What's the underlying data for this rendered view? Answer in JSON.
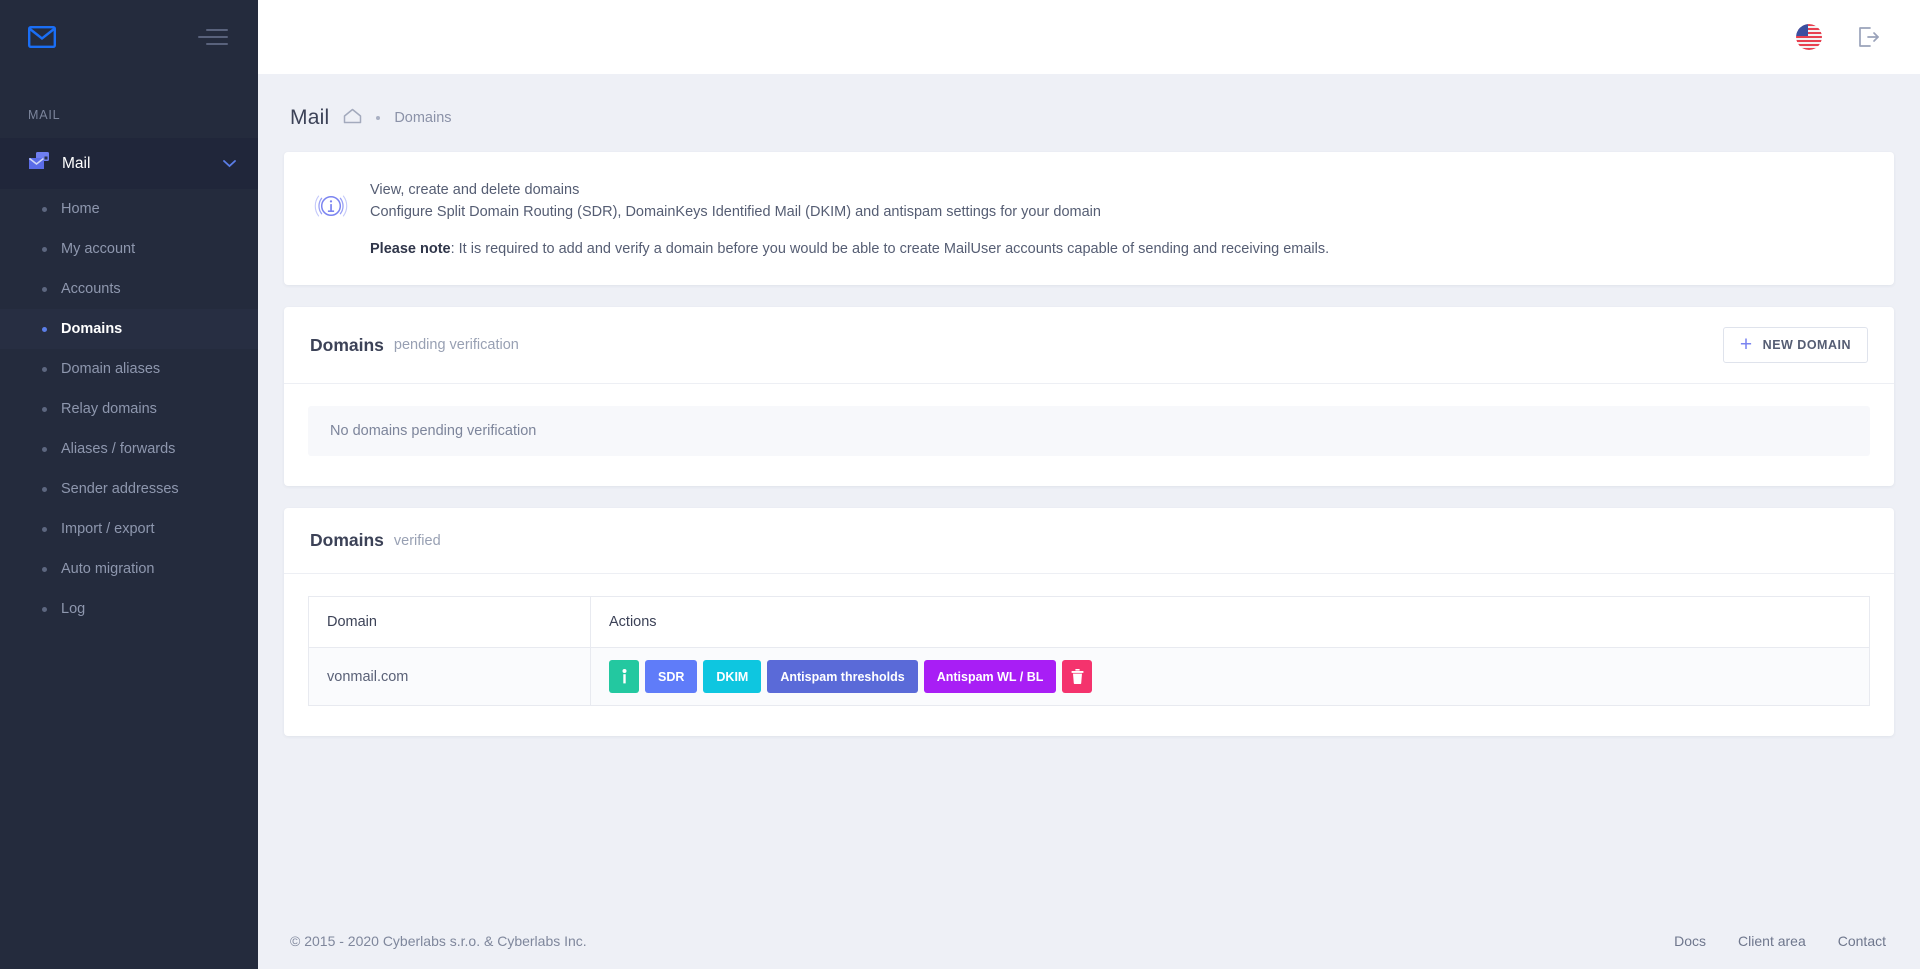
{
  "sidebar": {
    "logo_icon": "envelope-icon",
    "menu_icon": "hamburger-icon",
    "section_label": "MAIL",
    "group": {
      "label": "Mail",
      "icon": "mail-stack-icon",
      "chevron": "chevron-down-icon"
    },
    "items": [
      {
        "label": "Home",
        "active": false
      },
      {
        "label": "My account",
        "active": false
      },
      {
        "label": "Accounts",
        "active": false
      },
      {
        "label": "Domains",
        "active": true
      },
      {
        "label": "Domain aliases",
        "active": false
      },
      {
        "label": "Relay domains",
        "active": false
      },
      {
        "label": "Aliases / forwards",
        "active": false
      },
      {
        "label": "Sender addresses",
        "active": false
      },
      {
        "label": "Import / export",
        "active": false
      },
      {
        "label": "Auto migration",
        "active": false
      },
      {
        "label": "Log",
        "active": false
      }
    ]
  },
  "topbar": {
    "language_icon": "us-flag-icon",
    "logout_icon": "logout-icon"
  },
  "page": {
    "title": "Mail",
    "home_icon": "home-icon",
    "breadcrumb": "Domains"
  },
  "notice": {
    "icon": "info-circle-icon",
    "line1": "View, create and delete domains",
    "line2": "Configure Split Domain Routing (SDR), DomainKeys Identified Mail (DKIM) and antispam settings for your domain",
    "note_label": "Please note",
    "note_text": ": It is required to add and verify a domain before you would be able to create MailUser accounts capable of sending and receiving emails."
  },
  "pending_section": {
    "title": "Domains",
    "subtitle": "pending verification",
    "new_button": {
      "label": "NEW DOMAIN",
      "icon": "plus-icon"
    },
    "empty_text": "No domains pending verification"
  },
  "verified_section": {
    "title": "Domains",
    "subtitle": "verified",
    "columns": [
      "Domain",
      "Actions"
    ],
    "rows": [
      {
        "domain": "vonmail.com",
        "actions": [
          {
            "name": "info-button",
            "label": "",
            "icon": "info-icon",
            "color": "#23c8a0"
          },
          {
            "name": "sdr-button",
            "label": "SDR",
            "icon": "",
            "color": "#5f7cf9"
          },
          {
            "name": "dkim-button",
            "label": "DKIM",
            "icon": "",
            "color": "#0ec6e0"
          },
          {
            "name": "antispam-thresholds-button",
            "label": "Antispam thresholds",
            "icon": "",
            "color": "#5a6ad8"
          },
          {
            "name": "antispam-wl-bl-button",
            "label": "Antispam WL / BL",
            "icon": "",
            "color": "#a81ef5"
          },
          {
            "name": "delete-button",
            "label": "",
            "icon": "trash-icon",
            "color": "#f4336d"
          }
        ]
      }
    ]
  },
  "footer": {
    "copyright": "© 2015 - 2020 Cyberlabs s.r.o. & Cyberlabs Inc.",
    "links": [
      "Docs",
      "Client area",
      "Contact"
    ]
  },
  "colors": {
    "sidebar_bg": "#242b3d",
    "accent": "#5b7ee8",
    "content_bg": "#eef0f6"
  }
}
